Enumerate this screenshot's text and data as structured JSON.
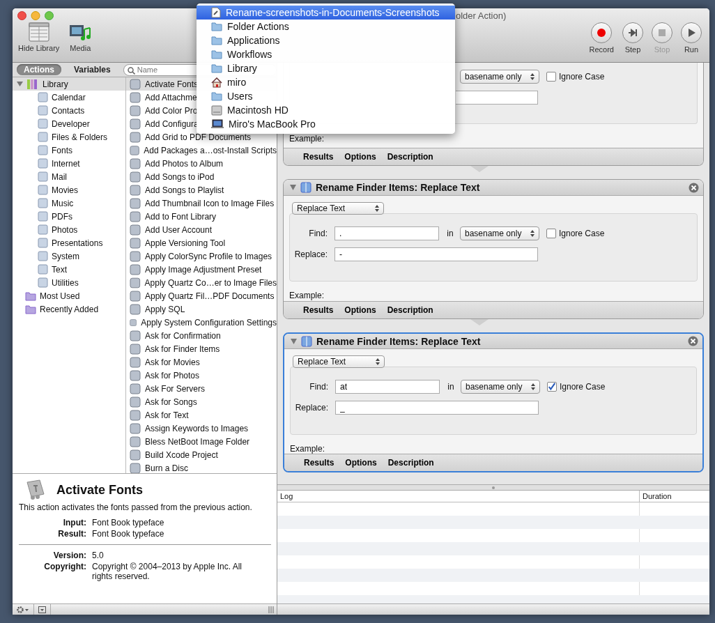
{
  "window": {
    "title": "older Action)"
  },
  "toolbar": {
    "left": [
      {
        "label": "Hide Library",
        "kind": "library"
      },
      {
        "label": "Media",
        "kind": "media"
      }
    ],
    "right": [
      {
        "label": "Record",
        "kind": "record",
        "disabled": false
      },
      {
        "label": "Step",
        "kind": "step",
        "disabled": false
      },
      {
        "label": "Stop",
        "kind": "stop",
        "disabled": true
      },
      {
        "label": "Run",
        "kind": "run",
        "disabled": false
      }
    ]
  },
  "library_tabs": [
    {
      "label": "Actions",
      "selected": true
    },
    {
      "label": "Variables",
      "selected": false
    }
  ],
  "search": {
    "placeholder": "Name"
  },
  "categories": [
    {
      "label": "Library",
      "kind": "root",
      "expanded": true,
      "selected": false,
      "children": [
        {
          "label": "Calendar",
          "selected": false
        },
        {
          "label": "Contacts",
          "selected": false
        },
        {
          "label": "Developer",
          "selected": false
        },
        {
          "label": "Files & Folders",
          "selected": false
        },
        {
          "label": "Fonts",
          "selected": false
        },
        {
          "label": "Internet",
          "selected": false
        },
        {
          "label": "Mail",
          "selected": false
        },
        {
          "label": "Movies",
          "selected": false
        },
        {
          "label": "Music",
          "selected": false
        },
        {
          "label": "PDFs",
          "selected": false
        },
        {
          "label": "Photos",
          "selected": false
        },
        {
          "label": "Presentations",
          "selected": false
        },
        {
          "label": "System",
          "selected": false
        },
        {
          "label": "Text",
          "selected": false
        },
        {
          "label": "Utilities",
          "selected": false
        }
      ]
    },
    {
      "label": "Most Used",
      "kind": "smart",
      "selected": false
    },
    {
      "label": "Recently Added",
      "kind": "smart",
      "selected": false
    }
  ],
  "action_list": [
    {
      "label": "Activate Fonts",
      "selected": true
    },
    {
      "label": "Add Attachme",
      "selected": false
    },
    {
      "label": "Add Color Pro",
      "selected": false
    },
    {
      "label": "Add Configura",
      "selected": false
    },
    {
      "label": "Add Grid to PDF Documents",
      "selected": false
    },
    {
      "label": "Add Packages a…ost-Install Scripts",
      "selected": false
    },
    {
      "label": "Add Photos to Album",
      "selected": false
    },
    {
      "label": "Add Songs to iPod",
      "selected": false
    },
    {
      "label": "Add Songs to Playlist",
      "selected": false
    },
    {
      "label": "Add Thumbnail Icon to Image Files",
      "selected": false
    },
    {
      "label": "Add to Font Library",
      "selected": false
    },
    {
      "label": "Add User Account",
      "selected": false
    },
    {
      "label": "Apple Versioning Tool",
      "selected": false
    },
    {
      "label": "Apply ColorSync Profile to Images",
      "selected": false
    },
    {
      "label": "Apply Image Adjustment Preset",
      "selected": false
    },
    {
      "label": "Apply Quartz Co…er to Image Files",
      "selected": false
    },
    {
      "label": "Apply Quartz Fil…PDF Documents",
      "selected": false
    },
    {
      "label": "Apply SQL",
      "selected": false
    },
    {
      "label": "Apply System Configuration Settings",
      "selected": false
    },
    {
      "label": "Ask for Confirmation",
      "selected": false
    },
    {
      "label": "Ask for Finder Items",
      "selected": false
    },
    {
      "label": "Ask for Movies",
      "selected": false
    },
    {
      "label": "Ask for Photos",
      "selected": false
    },
    {
      "label": "Ask For Servers",
      "selected": false
    },
    {
      "label": "Ask for Songs",
      "selected": false
    },
    {
      "label": "Ask for Text",
      "selected": false
    },
    {
      "label": "Assign Keywords to Images",
      "selected": false
    },
    {
      "label": "Bless NetBoot Image Folder",
      "selected": false
    },
    {
      "label": "Build Xcode Project",
      "selected": false
    },
    {
      "label": "Burn a Disc",
      "selected": false
    }
  ],
  "description": {
    "title": "Activate Fonts",
    "text": "This action activates the fonts passed from the previous action.",
    "io": [
      {
        "label": "Input:",
        "value": "Font Book typeface"
      },
      {
        "label": "Result:",
        "value": "Font Book typeface"
      }
    ],
    "info": [
      {
        "label": "Version:",
        "value": "5.0"
      },
      {
        "label": "Copyright:",
        "value": "Copyright © 2004–2013 by Apple Inc. All rights reserved."
      }
    ]
  },
  "workflow": [
    {
      "selected": false,
      "in_mode": "basename only",
      "ignore_case_label": "Ignore Case",
      "ignore_case": false,
      "example": "Example:",
      "tabs": [
        "Results",
        "Options",
        "Description"
      ]
    },
    {
      "title": "Rename Finder Items: Replace Text",
      "selected": false,
      "mode": "Replace Text",
      "find_label": "Find:",
      "find": ".",
      "in_label": "in",
      "in_mode": "basename only",
      "ignore_case_label": "Ignore Case",
      "ignore_case": false,
      "replace_label": "Replace:",
      "replace": "-",
      "example": "Example:",
      "tabs": [
        "Results",
        "Options",
        "Description"
      ]
    },
    {
      "title": "Rename Finder Items: Replace Text",
      "selected": true,
      "mode": "Replace Text",
      "find_label": "Find:",
      "find": "at",
      "in_label": "in",
      "in_mode": "basename only",
      "ignore_case_label": "Ignore Case",
      "ignore_case": true,
      "replace_label": "Replace:",
      "replace": "_",
      "example": "Example:",
      "tabs": [
        "Results",
        "Options",
        "Description"
      ]
    }
  ],
  "log": {
    "columns": [
      "Log",
      "Duration"
    ]
  },
  "location_menu": {
    "items": [
      {
        "label": "Rename-screenshots-in-Documents-Screenshots",
        "kind": "document",
        "selected": true
      },
      {
        "label": "Folder Actions",
        "kind": "folder",
        "selected": false
      },
      {
        "label": "Applications",
        "kind": "folder",
        "selected": false
      },
      {
        "label": "Workflows",
        "kind": "folder",
        "selected": false
      },
      {
        "label": "Library",
        "kind": "folder",
        "selected": false
      },
      {
        "label": "miro",
        "kind": "home",
        "selected": false
      },
      {
        "label": "Users",
        "kind": "folder",
        "selected": false
      },
      {
        "label": "Macintosh HD",
        "kind": "drive",
        "selected": false
      },
      {
        "label": "Miro's MacBook Pro",
        "kind": "computer",
        "selected": false
      }
    ]
  }
}
